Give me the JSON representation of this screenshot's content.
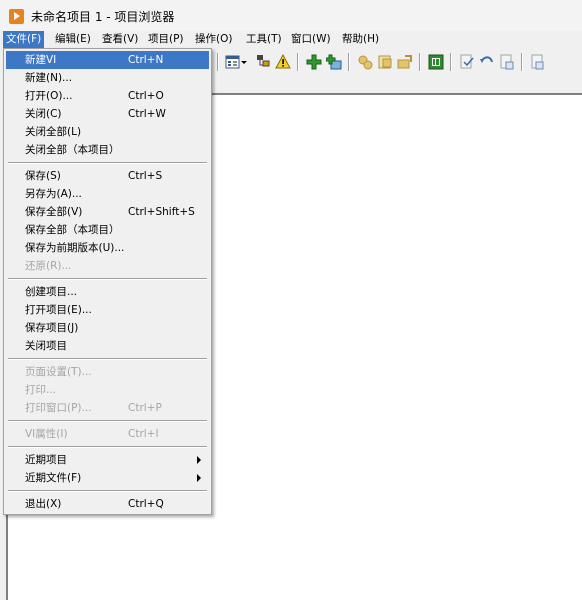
{
  "window": {
    "title": "未命名项目 1 - 项目浏览器"
  },
  "menubar": {
    "items": [
      "文件(F)",
      "编辑(E)",
      "查看(V)",
      "项目(P)",
      "操作(O)",
      "工具(T)",
      "窗口(W)",
      "帮助(H)"
    ],
    "active_index": 0
  },
  "file_menu": {
    "groups": [
      [
        {
          "label": "新建VI",
          "shortcut": "Ctrl+N",
          "enabled": true,
          "highlighted": true
        },
        {
          "label": "新建(N)...",
          "shortcut": "",
          "enabled": true
        },
        {
          "label": "打开(O)...",
          "shortcut": "Ctrl+O",
          "enabled": true
        },
        {
          "label": "关闭(C)",
          "shortcut": "Ctrl+W",
          "enabled": true
        },
        {
          "label": "关闭全部(L)",
          "shortcut": "",
          "enabled": true
        },
        {
          "label": "关闭全部（本项目）",
          "shortcut": "",
          "enabled": true
        }
      ],
      [
        {
          "label": "保存(S)",
          "shortcut": "Ctrl+S",
          "enabled": true
        },
        {
          "label": "另存为(A)...",
          "shortcut": "",
          "enabled": true
        },
        {
          "label": "保存全部(V)",
          "shortcut": "Ctrl+Shift+S",
          "enabled": true
        },
        {
          "label": "保存全部（本项目）",
          "shortcut": "",
          "enabled": true
        },
        {
          "label": "保存为前期版本(U)...",
          "shortcut": "",
          "enabled": true
        },
        {
          "label": "还原(R)...",
          "shortcut": "",
          "enabled": false
        }
      ],
      [
        {
          "label": "创建项目...",
          "shortcut": "",
          "enabled": true
        },
        {
          "label": "打开项目(E)...",
          "shortcut": "",
          "enabled": true
        },
        {
          "label": "保存项目(J)",
          "shortcut": "",
          "enabled": true
        },
        {
          "label": "关闭项目",
          "shortcut": "",
          "enabled": true
        }
      ],
      [
        {
          "label": "页面设置(T)...",
          "shortcut": "",
          "enabled": false
        },
        {
          "label": "打印...",
          "shortcut": "",
          "enabled": false
        },
        {
          "label": "打印窗口(P)...",
          "shortcut": "Ctrl+P",
          "enabled": false
        }
      ],
      [
        {
          "label": "VI属性(I)",
          "shortcut": "Ctrl+I",
          "enabled": false
        }
      ],
      [
        {
          "label": "近期项目",
          "shortcut": "",
          "enabled": true,
          "submenu": true
        },
        {
          "label": "近期文件(F)",
          "shortcut": "",
          "enabled": true,
          "submenu": true
        }
      ],
      [
        {
          "label": "退出(X)",
          "shortcut": "Ctrl+Q",
          "enabled": true
        }
      ]
    ]
  },
  "toolbar": {
    "icons": [
      "view-options-icon",
      "dropdown-arrow-icon",
      "hierarchy-icon",
      "warning-icon",
      "add-green-icon",
      "add-folder-icon",
      "build-icon",
      "build-spec-icon",
      "deploy-icon",
      "labview-pane-icon",
      "vi-check-icon",
      "undo-icon",
      "vi-doc-icon",
      "new-doc-icon"
    ]
  },
  "colors": {
    "highlight": "#3c78c6",
    "disabled_text": "#a5a5a5",
    "app_icon": "#e8821e"
  }
}
